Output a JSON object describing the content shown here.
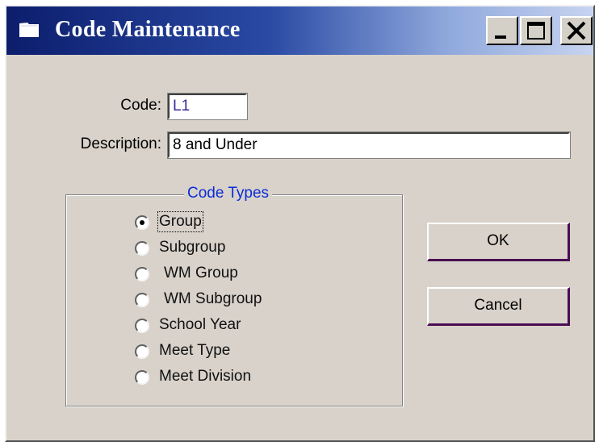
{
  "window": {
    "title": "Code Maintenance",
    "controls": {
      "minimize_icon": "minimize-icon",
      "maximize_icon": "maximize-icon",
      "close_icon": "close-icon"
    },
    "title_gradient": [
      "#0c1d6c",
      "#8fa8dc"
    ]
  },
  "form": {
    "code_label": "Code:",
    "code_value": "L1",
    "description_label": "Description:",
    "description_value": "8 and Under"
  },
  "code_types": {
    "legend": "Code Types",
    "legend_color": "#0a2cd8",
    "options": [
      {
        "label": "Group",
        "selected": true
      },
      {
        "label": "Subgroup",
        "selected": false
      },
      {
        "label": "WM Group",
        "selected": false
      },
      {
        "label": "WM Subgroup",
        "selected": false
      },
      {
        "label": "School Year",
        "selected": false
      },
      {
        "label": "Meet Type",
        "selected": false
      },
      {
        "label": "Meet Division",
        "selected": false
      }
    ]
  },
  "buttons": {
    "ok_label": "OK",
    "cancel_label": "Cancel"
  }
}
